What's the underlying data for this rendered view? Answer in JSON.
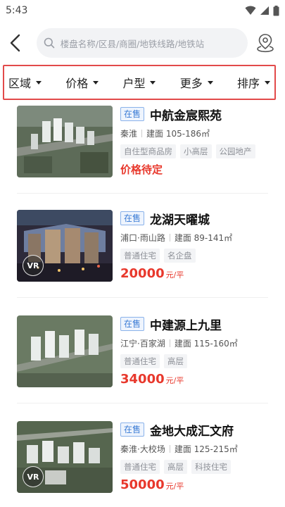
{
  "status_bar": {
    "time": "5:43"
  },
  "search": {
    "placeholder": "楼盘名称/区县/商圈/地铁线路/地铁站"
  },
  "filters": [
    "区域",
    "价格",
    "户型",
    "更多",
    "排序"
  ],
  "listings": [
    {
      "status": "在售",
      "name": "中航金宸熙苑",
      "district": "秦淮",
      "area": "建面 105-186㎡",
      "tags": [
        "自住型商品房",
        "小高层",
        "公园地产"
      ],
      "price_text": "价格待定",
      "has_vr": false
    },
    {
      "status": "在售",
      "name": "龙湖天曜城",
      "district": "浦口·雨山路",
      "area": "建面 89-141㎡",
      "tags": [
        "普通住宅",
        "名企盘"
      ],
      "price_num": "20000",
      "price_unit": "元/平",
      "has_vr": true
    },
    {
      "status": "在售",
      "name": "中建源上九里",
      "district": "江宁·百家湖",
      "area": "建面 115-160㎡",
      "tags": [
        "普通住宅",
        "高层"
      ],
      "price_num": "34000",
      "price_unit": "元/平",
      "has_vr": false
    },
    {
      "status": "在售",
      "name": "金地大成汇文府",
      "district": "秦淮·大校场",
      "area": "建面 125-215㎡",
      "tags": [
        "普通住宅",
        "高层",
        "科技住宅"
      ],
      "price_num": "50000",
      "price_unit": "元/平",
      "has_vr": true
    }
  ],
  "vr_label": "VR",
  "colors": {
    "accent_red": "#e8382c",
    "tag_blue": "#3a7bd5",
    "highlight_border": "#e24a4a"
  }
}
